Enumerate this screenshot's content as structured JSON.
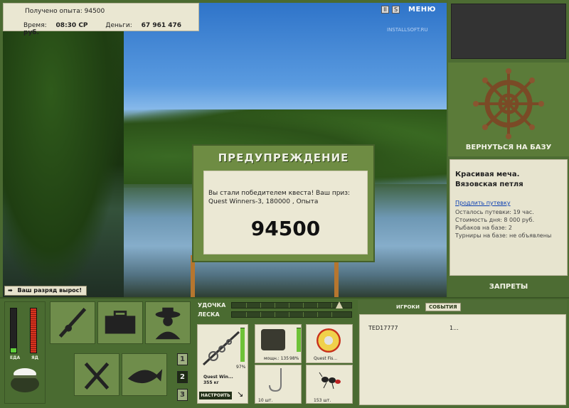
{
  "hud": {
    "experience_label": "Получено опыта:",
    "experience_value": "94500",
    "time_label": "Время:",
    "time_value": "08:30 СР",
    "money_label": "Деньги:",
    "money_value": "67 961 476 руб."
  },
  "top_controls": {
    "pause_label": "II",
    "sound_label": "S",
    "menu_label": "МЕНЮ"
  },
  "watermark": "INSTALLSOFT.RU",
  "rank_message": "Ваш разряд вырос!",
  "dialog": {
    "title": "ПРЕДУПРЕЖДЕНИЕ",
    "message": "Вы стали победителем квеста! Ваш приз: Quest Winners-3, 180000 , Опыта",
    "value": "94500"
  },
  "right_panel": {
    "return_label": "ВЕРНУТЬСЯ НА БАЗУ",
    "base_name": "Красивая меча. Вязовская петля",
    "extend_link": "Продлить путевку",
    "lines": [
      "Осталось путевки: 19 час.",
      "Стоимость дня: 8 000 руб.",
      "Рыбаков на базе: 2",
      "Турниры на базе: не объявлены"
    ],
    "bans_label": "ЗАПРЕТЫ"
  },
  "meters": {
    "food_label": "ЕДА",
    "food_level": 0.1,
    "poison_label": "ЯД",
    "poison_level": 1.0
  },
  "page_buttons": [
    "1",
    "2",
    "3"
  ],
  "tackle": {
    "rod_label": "УДОЧКА",
    "line_label": "ЛЕСКА",
    "rod_name": "Quest Win...",
    "rod_weight": "355 кг",
    "rod_percent": "97%",
    "rod_level": 0.97,
    "reel_name": "мощн.: 135",
    "reel_percent": "98%",
    "reel_level": 0.98,
    "line_name": "Quest Fis...",
    "hook_count": "10 шт.",
    "bait_count": "153 шт.",
    "setup_label": "НАСТРОИТЬ"
  },
  "players": {
    "tab_players": "ИГРОКИ",
    "tab_events": "СОБЫТИЯ",
    "rows": [
      {
        "name": "TED17777",
        "value": "1..."
      }
    ]
  }
}
